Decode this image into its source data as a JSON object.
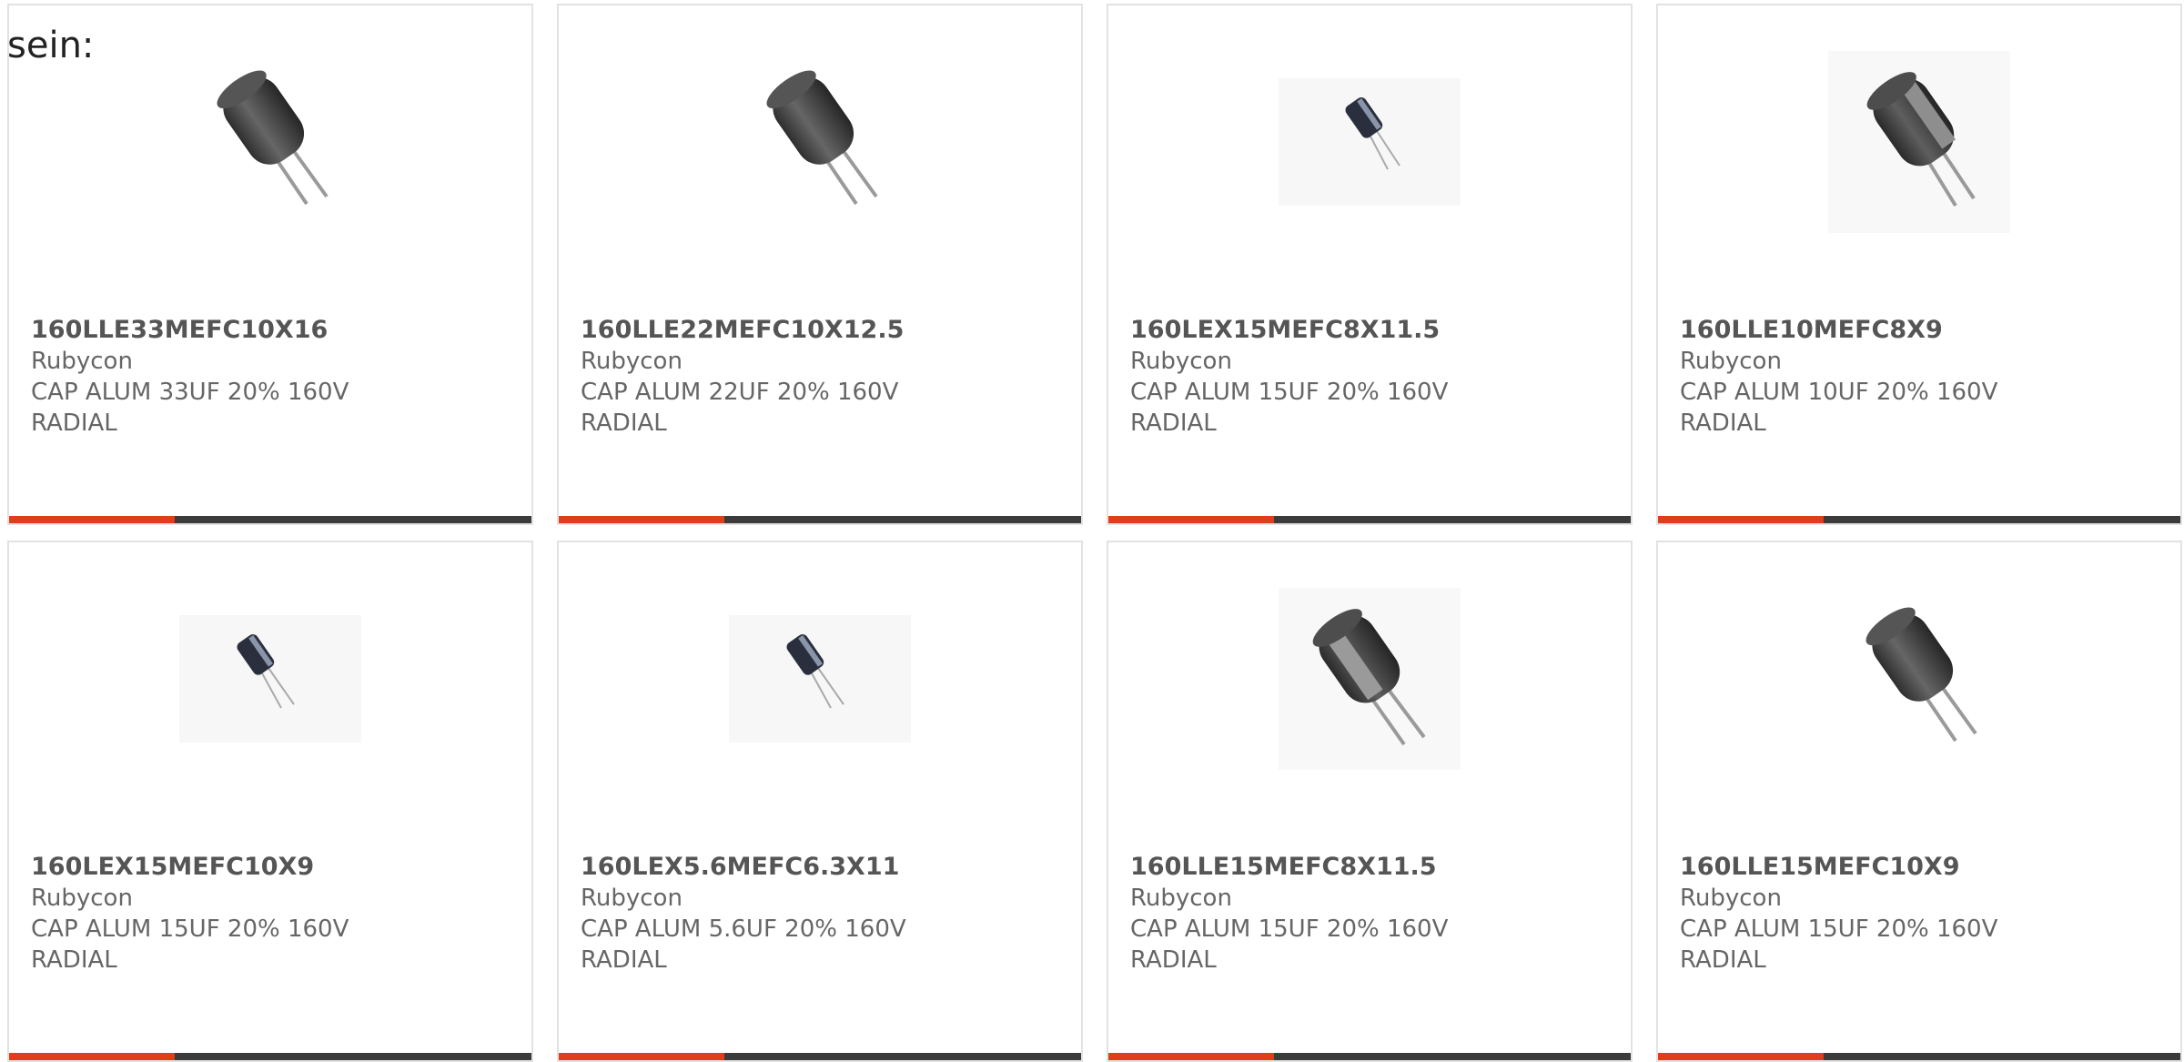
{
  "intro_text": "sein:",
  "colors": {
    "accent": "#e03d1a",
    "bar": "#3b3b3b",
    "card_border": "#e2e2e2"
  },
  "products": [
    {
      "part_number": "160LLE33MEFC10X16",
      "manufacturer": "Rubycon",
      "description_line1": "CAP ALUM 33UF 20% 160V",
      "description_line2": "RADIAL",
      "image_icon": "radial-capacitor-large-icon"
    },
    {
      "part_number": "160LLE22MEFC10X12.5",
      "manufacturer": "Rubycon",
      "description_line1": "CAP ALUM 22UF 20% 160V",
      "description_line2": "RADIAL",
      "image_icon": "radial-capacitor-large-icon"
    },
    {
      "part_number": "160LEX15MEFC8X11.5",
      "manufacturer": "Rubycon",
      "description_line1": "CAP ALUM 15UF 20% 160V",
      "description_line2": "RADIAL",
      "image_icon": "radial-capacitor-small-icon"
    },
    {
      "part_number": "160LLE10MEFC8X9",
      "manufacturer": "Rubycon",
      "description_line1": "CAP ALUM 10UF 20% 160V",
      "description_line2": "RADIAL",
      "image_icon": "radial-capacitor-striped-icon"
    },
    {
      "part_number": "160LEX15MEFC10X9",
      "manufacturer": "Rubycon",
      "description_line1": "CAP ALUM 15UF 20% 160V",
      "description_line2": "RADIAL",
      "image_icon": "radial-capacitor-small-icon"
    },
    {
      "part_number": "160LEX5.6MEFC6.3X11",
      "manufacturer": "Rubycon",
      "description_line1": "CAP ALUM 5.6UF 20% 160V",
      "description_line2": "RADIAL",
      "image_icon": "radial-capacitor-small-icon"
    },
    {
      "part_number": "160LLE15MEFC8X11.5",
      "manufacturer": "Rubycon",
      "description_line1": "CAP ALUM 15UF 20% 160V",
      "description_line2": "RADIAL",
      "image_icon": "radial-capacitor-striped-icon"
    },
    {
      "part_number": "160LLE15MEFC10X9",
      "manufacturer": "Rubycon",
      "description_line1": "CAP ALUM 15UF 20% 160V",
      "description_line2": "RADIAL",
      "image_icon": "radial-capacitor-large-icon"
    }
  ]
}
